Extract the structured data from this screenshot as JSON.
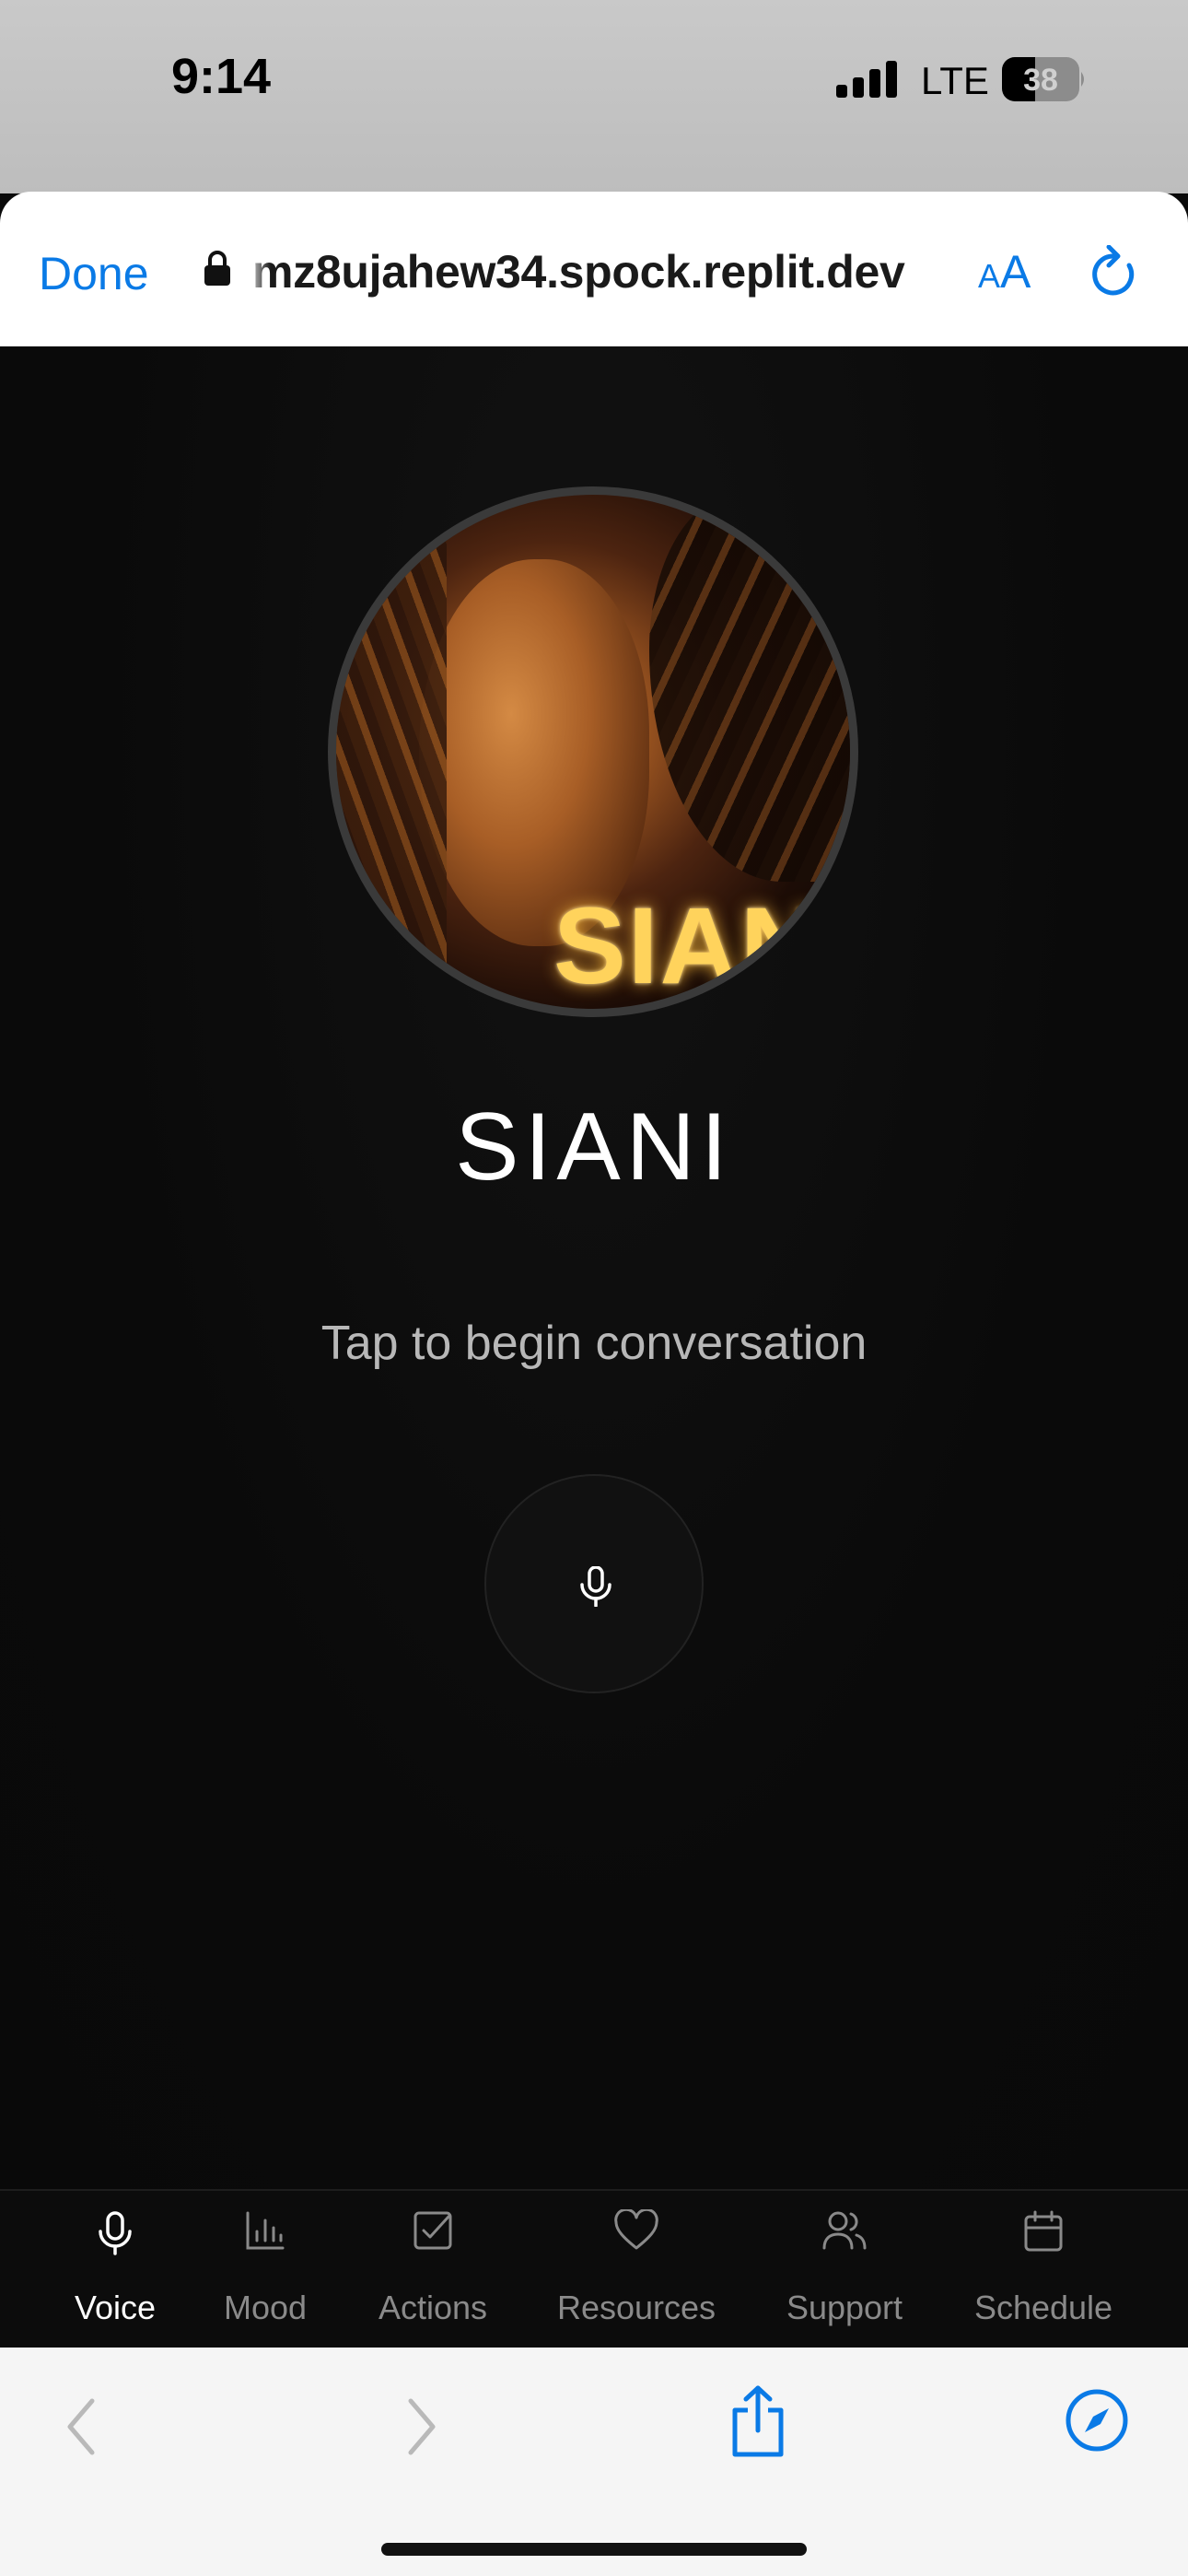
{
  "status_bar": {
    "time": "9:14",
    "network": "LTE",
    "battery": "38"
  },
  "browser": {
    "done_label": "Done",
    "url": "mz8ujahew34.spock.replit.dev",
    "aa_small": "A",
    "aa_big": "A"
  },
  "app": {
    "avatar_logo": "SIAN",
    "title": "SIANI",
    "subtitle": "Tap to begin conversation"
  },
  "tabs": [
    {
      "label": "Voice",
      "icon": "mic-icon",
      "active": true
    },
    {
      "label": "Mood",
      "icon": "bar-chart-icon",
      "active": false
    },
    {
      "label": "Actions",
      "icon": "checkbox-icon",
      "active": false
    },
    {
      "label": "Resources",
      "icon": "heart-icon",
      "active": false
    },
    {
      "label": "Support",
      "icon": "users-icon",
      "active": false
    },
    {
      "label": "Schedule",
      "icon": "calendar-icon",
      "active": false
    }
  ],
  "colors": {
    "accent": "#0a7ae6",
    "app_background": "#0a0a0a",
    "logo_glow": "#ffd35c"
  }
}
